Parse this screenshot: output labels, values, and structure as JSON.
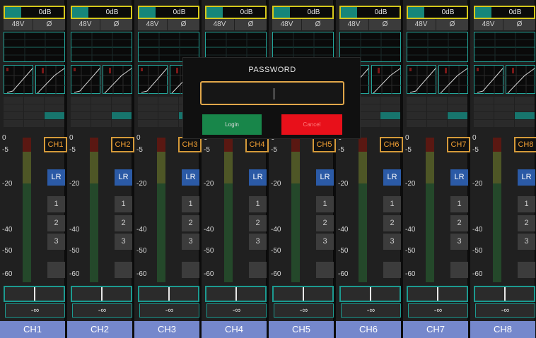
{
  "channels": [
    {
      "gain": "0dB",
      "phantom": "48V",
      "phase": "Ø",
      "name": "CH1",
      "lr": "LR",
      "bus1": "1",
      "bus2": "2",
      "bus3": "3",
      "volume": "-∞",
      "label": "CH1"
    },
    {
      "gain": "0dB",
      "phantom": "48V",
      "phase": "Ø",
      "name": "CH2",
      "lr": "LR",
      "bus1": "1",
      "bus2": "2",
      "bus3": "3",
      "volume": "-∞",
      "label": "CH2"
    },
    {
      "gain": "0dB",
      "phantom": "48V",
      "phase": "Ø",
      "name": "CH3",
      "lr": "LR",
      "bus1": "1",
      "bus2": "2",
      "bus3": "3",
      "volume": "-∞",
      "label": "CH3"
    },
    {
      "gain": "0dB",
      "phantom": "48V",
      "phase": "Ø",
      "name": "CH4",
      "lr": "LR",
      "bus1": "1",
      "bus2": "2",
      "bus3": "3",
      "volume": "-∞",
      "label": "CH4"
    },
    {
      "gain": "0dB",
      "phantom": "48V",
      "phase": "Ø",
      "name": "CH5",
      "lr": "LR",
      "bus1": "1",
      "bus2": "2",
      "bus3": "3",
      "volume": "-∞",
      "label": "CH5"
    },
    {
      "gain": "0dB",
      "phantom": "48V",
      "phase": "Ø",
      "name": "CH6",
      "lr": "LR",
      "bus1": "1",
      "bus2": "2",
      "bus3": "3",
      "volume": "-∞",
      "label": "CH6"
    },
    {
      "gain": "0dB",
      "phantom": "48V",
      "phase": "Ø",
      "name": "CH7",
      "lr": "LR",
      "bus1": "1",
      "bus2": "2",
      "bus3": "3",
      "volume": "-∞",
      "label": "CH7"
    },
    {
      "gain": "0dB",
      "phantom": "48V",
      "phase": "Ø",
      "name": "CH8",
      "lr": "LR",
      "bus1": "1",
      "bus2": "2",
      "bus3": "3",
      "volume": "-∞",
      "label": "CH8"
    }
  ],
  "meter_scale": [
    "0",
    "-5",
    "-20",
    "-40",
    "-50",
    "-60"
  ],
  "dialog": {
    "title": "PASSWORD",
    "password_value": "",
    "login_label": "Login",
    "cancel_label": "Cancel"
  },
  "colors": {
    "gain_border": "#d6c81c",
    "accent_teal": "#1c9a90",
    "channel_label_bg": "#7588cc",
    "lr_button": "#2b5aa6",
    "login_button": "#18864a",
    "cancel_button": "#e8101a",
    "channel_name_border": "#d59a3a"
  }
}
